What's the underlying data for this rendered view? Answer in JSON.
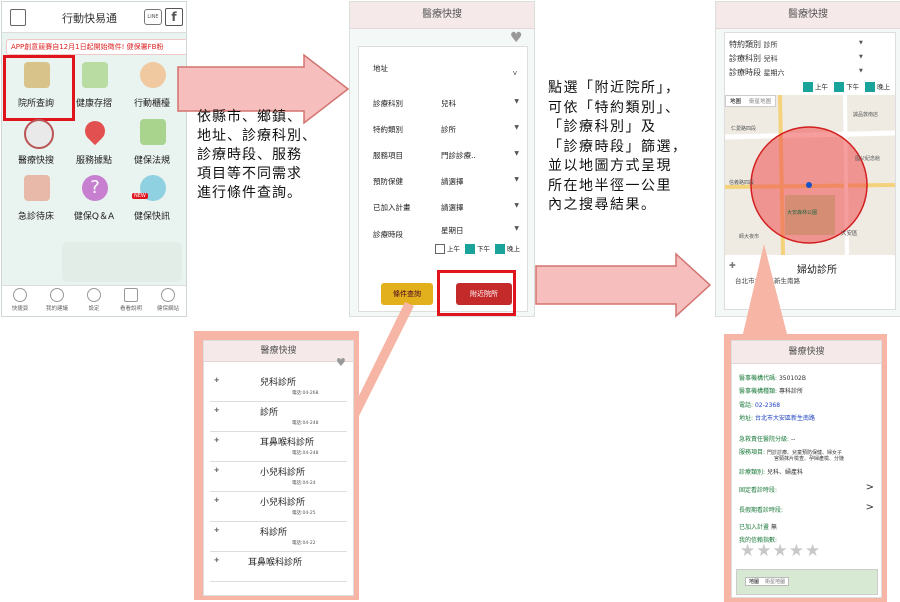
{
  "screen1": {
    "title": "行動快易通",
    "badge_line": "LINE",
    "badge_fb": "f",
    "banner": "APP創意競賽自12月1日起開始徵件! 健保署FB粉",
    "tiles": [
      {
        "label": "院所查詢"
      },
      {
        "label": "健康存摺"
      },
      {
        "label": "行動櫃檯"
      },
      {
        "label": "醫療快搜"
      },
      {
        "label": "服務據點"
      },
      {
        "label": "健保法規"
      },
      {
        "label": "急診待床"
      },
      {
        "label": "健保Q＆A"
      },
      {
        "label": "健保快訊"
      }
    ],
    "new_badge": "NEW",
    "tabs": [
      "快捷頁",
      "我的建議",
      "設定",
      "看看說明",
      "健保網站"
    ]
  },
  "desc1": [
    "依縣市、鄉鎮、",
    "地址、診療科別、",
    "診療時段、服務",
    "項目等不同需求",
    "進行條件查詢。"
  ],
  "screen2": {
    "title": "醫療快搜",
    "address_label": "地址",
    "address_value": "v",
    "rows": [
      {
        "key": "診療科別",
        "value": "兒科"
      },
      {
        "key": "特約類別",
        "value": "診所"
      },
      {
        "key": "服務項目",
        "value": "門診診療.."
      },
      {
        "key": "預防保健",
        "value": "請選擇"
      },
      {
        "key": "已加入計畫",
        "value": "請選擇"
      },
      {
        "key": "診療時段",
        "value": "星期日"
      }
    ],
    "periods": [
      "上午",
      "下午",
      "晚上"
    ],
    "btn_query": "條件查詢",
    "btn_nearby": "附近院所"
  },
  "desc2": [
    "點選「附近院所」，",
    "可依「特約類別」、",
    "「診療科別」及",
    "「診療時段」篩選，",
    "並以地圖方式呈現",
    "所在地半徑一公里",
    "內之搜尋結果。"
  ],
  "screen3": {
    "title": "醫療快搜",
    "filters": [
      {
        "key": "特約類別",
        "value": "診所"
      },
      {
        "key": "診療科別",
        "value": "兒科"
      },
      {
        "key": "診療時段",
        "value": "星期六"
      }
    ],
    "periods": [
      "上午",
      "下午",
      "晚上"
    ],
    "map_tabs": [
      "地圖",
      "衛星地圖"
    ],
    "map_labels": [
      "誠品敦南店",
      "仁愛路四段",
      "信義路四段",
      "大安森林公園",
      "大安區",
      "國父紀念館",
      "師大夜市"
    ],
    "result_name": "婦幼診所",
    "result_addr": "台北市大安區新生南路"
  },
  "screen4": {
    "title": "醫療快搜",
    "items": [
      {
        "name": "兒科診所",
        "phone": "電話:04-268"
      },
      {
        "name": "診所",
        "phone": "電話:04-248"
      },
      {
        "name": "耳鼻喉科診所",
        "phone": "電話:04-248"
      },
      {
        "name": "小兒科診所",
        "phone": "電話:04-24"
      },
      {
        "name": "小兒科診所",
        "phone": "電話:04-25"
      },
      {
        "name": "科診所",
        "phone": "電話:04-22"
      },
      {
        "name": "耳鼻喉科診所",
        "phone": ""
      }
    ]
  },
  "screen5": {
    "title": "醫療快搜",
    "code_label": "醫事機構代碼:",
    "code_value": "350102B",
    "type_label": "醫事機構種類:",
    "type_value": "專科診所",
    "phone_label": "電話:",
    "phone_value": "02-2368",
    "addr_label": "地址:",
    "addr_value": "台北市大安區新生南路",
    "er_label": "急救責任醫院分級:",
    "er_value": "--",
    "service_label": "服務項目:",
    "service_value1": "門診診療、兒童預防保健、婦女子",
    "service_value2": "宮頸抹片檢查、孕婦產檢、分娩",
    "dept_label": "診療類別:",
    "dept_value": "兒科、婦產科",
    "fixed_hours": "固定看診時段:",
    "holiday_hours": "長假期看診時段:",
    "plan_label": "已加入計畫",
    "plan_value": "無",
    "rating_label": "我的信賴指數:",
    "map_tabs": [
      "地圖",
      "衛星地圖"
    ]
  }
}
